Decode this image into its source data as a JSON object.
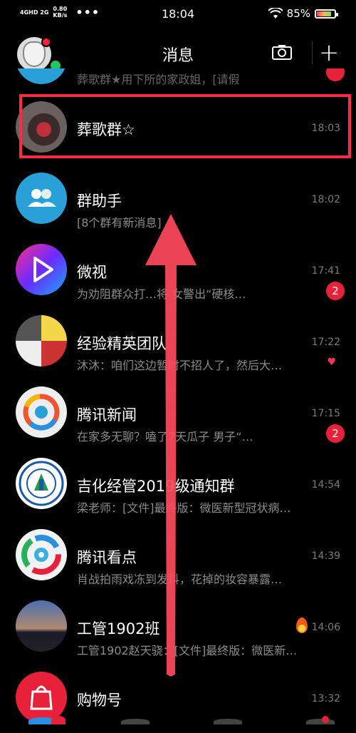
{
  "status_bar": {
    "network_top": "4GHD  2G",
    "speed": "0.80",
    "speed_unit": "KB/s",
    "dots": "•••",
    "time": "18:04",
    "battery": "85%"
  },
  "header": {
    "title": "消息"
  },
  "partial_top": {
    "msg": "葬歌群★用下所的家政姐，[请假"
  },
  "chats": [
    {
      "name": "葬歌群☆",
      "msg": "",
      "time": "18:03",
      "badge": ""
    },
    {
      "name": "群助手",
      "msg": "[8个群有新消息]",
      "time": "18:02",
      "badge": ""
    },
    {
      "name": "微视",
      "msg": "为劝阻群众打…将 女警出“硬核…",
      "time": "17:41",
      "badge": "2"
    },
    {
      "name": "经验精英团队",
      "msg": "沐沐：咱们这边暂时不招人了，然后大…",
      "time": "17:22",
      "badge": ""
    },
    {
      "name": "腾讯新闻",
      "msg": "在家多无聊？嗑了7天瓜子 男子“…",
      "time": "17:15",
      "badge": "2"
    },
    {
      "name": "吉化经管2019级通知群",
      "msg": "梁老师：[文件]最终版：微医新型冠状病…",
      "time": "14:54",
      "badge": ""
    },
    {
      "name": "腾讯看点",
      "msg": "肖战拍雨戏冻到发抖，花掉的妆容暴露…",
      "time": "14:39",
      "badge": ""
    },
    {
      "name": "工管1902班",
      "msg": "工管1902赵天骁：[文件]最终版：微医新…",
      "time": "14:06",
      "badge": ""
    },
    {
      "name": "购物号",
      "msg": "",
      "time": "13:32",
      "badge": ""
    }
  ],
  "colors": {
    "highlight": "#ff2a44",
    "badge": "#e8213a",
    "online": "#1ec85f"
  }
}
